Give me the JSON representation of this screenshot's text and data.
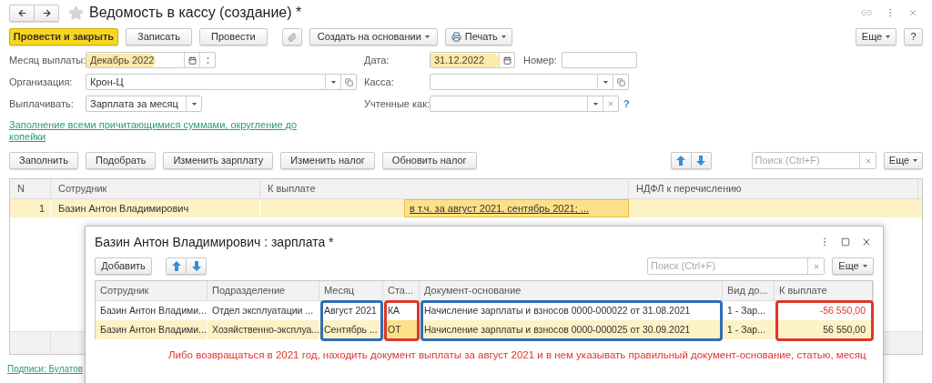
{
  "window": {
    "title": "Ведомость в кассу (создание) *"
  },
  "toolbar": {
    "buttons": [
      {
        "label": "Провести и закрыть",
        "kind": "primary"
      },
      {
        "label": "Записать",
        "kind": "plain"
      },
      {
        "label": "Провести",
        "kind": "plain"
      },
      {
        "kind": "attach"
      },
      {
        "label": "Создать на основании",
        "kind": "menu"
      },
      {
        "label": "Печать",
        "kind": "print"
      }
    ],
    "more": "Еще",
    "help": "?"
  },
  "form": {
    "left": [
      {
        "label": "Месяц выплаты:",
        "value": "Декабрь 2022",
        "highlighted": true,
        "kind": "month"
      },
      {
        "label": "Организация:",
        "value": "Крон-Ц",
        "highlighted": false,
        "kind": "reference"
      },
      {
        "label": "Выплачивать:",
        "value": "Зарплата за месяц",
        "highlighted": false,
        "kind": "choice"
      }
    ],
    "right": [
      {
        "label": "Дата:",
        "value": "31.12.2022",
        "highlighted": true,
        "kind": "date",
        "extra_label": "Номер:"
      },
      {
        "label": "Касса:",
        "highlighted": false,
        "kind": "reference"
      },
      {
        "label": "Учтенные как:",
        "highlighted": false,
        "kind": "clearable",
        "hint": "?"
      }
    ]
  },
  "fill_link": "Заполнение всеми причитающимися суммами, округление до копейки",
  "table_toolbar": {
    "buttons": [
      "Заполнить",
      "Подобрать",
      "Изменить зарплату",
      "Изменить налог",
      "Обновить налог"
    ],
    "search": {
      "placeholder": "Поиск (Ctrl+F)"
    },
    "more": "Еще"
  },
  "table": {
    "columns": [
      "N",
      "Сотрудник",
      "К выплате",
      "НДФЛ к перечислению"
    ],
    "rows": [
      {
        "n": "1",
        "employee": "Базин Антон Владимирович",
        "payout": "в т.ч. за август 2021, сентябрь 2021; ...",
        "selected": true
      }
    ]
  },
  "signatures_link": "Подписи: Булатов",
  "dialog": {
    "title": "Базин Антон Владимирович : зарплата *",
    "add": "Добавить",
    "search": {
      "placeholder": "Поиск (Ctrl+F)"
    },
    "more": "Еще",
    "columns": [
      {
        "label": "Сотрудник"
      },
      {
        "label": "Подразделение"
      },
      {
        "label": "Месяц",
        "color": "#2f6db4"
      },
      {
        "label": "Ста...",
        "color": "#e0352b"
      },
      {
        "label": "Документ-основание",
        "color": "#2f6db4"
      },
      {
        "label": "Вид до..."
      },
      {
        "label": "К выплате",
        "color": "#e0352b"
      }
    ],
    "rows": [
      {
        "cells": [
          "Базин Антон Владими...",
          "Отдел эксплуатации ...",
          "Август 2021",
          "КА",
          "Начисление зарплаты и взносов 0000-000022 от 31.08.2021",
          "1 - Зар...",
          "-56 550,00"
        ],
        "negative": true,
        "selected": false
      },
      {
        "cells": [
          "Базин Антон Владими...",
          "Хозяйственно-эксплуа...",
          "Сентябрь ...",
          "ОТ",
          "Начисление зарплаты и взносов 0000-000025 от 30.09.2021",
          "1 - Зар...",
          "56 550,00"
        ],
        "negative": false,
        "selected": true
      }
    ],
    "note": "Либо возвращаться в 2021 год, находить документ выплаты за август 2021 и в нем указывать правильный документ-основание, статью, месяц"
  }
}
